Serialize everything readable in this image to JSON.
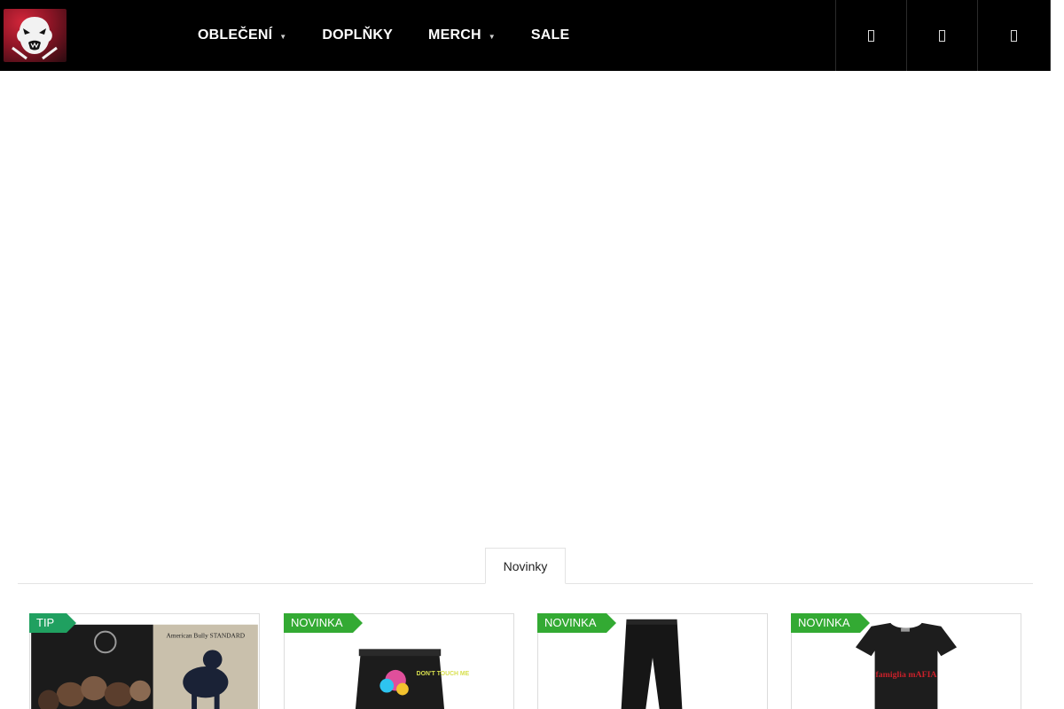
{
  "header": {
    "logo_alt": "logo",
    "nav": [
      {
        "label": "OBLEČENÍ",
        "has_dropdown": true
      },
      {
        "label": "DOPLŇKY",
        "has_dropdown": false
      },
      {
        "label": "MERCH",
        "has_dropdown": true
      },
      {
        "label": "SALE",
        "has_dropdown": false
      }
    ],
    "icons": [
      "search-icon",
      "user-icon",
      "cart-icon"
    ]
  },
  "tabs": {
    "active": "Novinky"
  },
  "products": [
    {
      "flag": "TIP",
      "image": "book-cover",
      "cover_text": "American Bully STANDARD"
    },
    {
      "flag": "NOVINKA",
      "image": "shorts",
      "print_text": "DON'T TOUCH ME"
    },
    {
      "flag": "NOVINKA",
      "image": "leggings"
    },
    {
      "flag": "NOVINKA",
      "image": "tshirt",
      "print_text": "famiglia mAFIA"
    }
  ],
  "colors": {
    "header_bg": "#000000",
    "flag_tip": "#20a060",
    "flag_new": "#33aa33",
    "print_red": "#c8202a"
  }
}
